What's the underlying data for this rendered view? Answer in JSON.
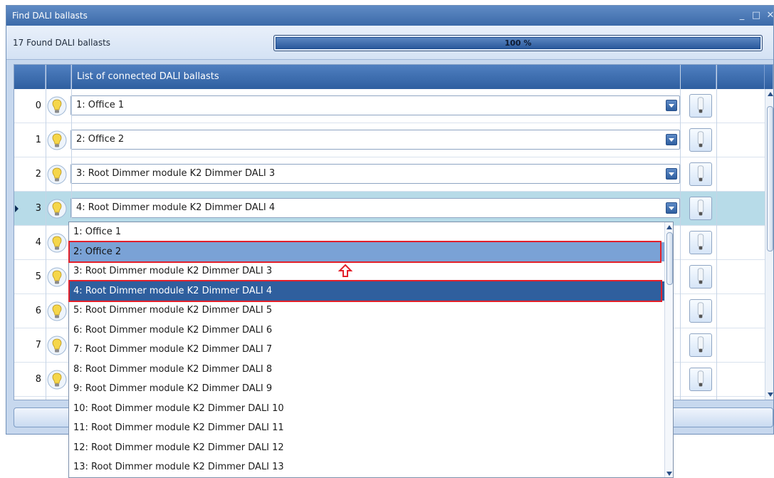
{
  "window": {
    "title": "Find DALI ballasts",
    "controls": [
      "_",
      "□",
      "✕"
    ]
  },
  "status": {
    "found_text": "17 Found DALI ballasts",
    "progress_value": 100,
    "progress_text": "100 %"
  },
  "grid": {
    "header": "List of connected DALI ballasts",
    "rows": [
      {
        "index": "0",
        "value": "1: Office 1"
      },
      {
        "index": "1",
        "value": "2: Office 2"
      },
      {
        "index": "2",
        "value": "3: Root Dimmer module K2 Dimmer DALI 3"
      },
      {
        "index": "3",
        "value": "4: Root Dimmer module K2 Dimmer DALI 4",
        "selected": true
      },
      {
        "index": "4",
        "value": ""
      },
      {
        "index": "5",
        "value": ""
      },
      {
        "index": "6",
        "value": ""
      },
      {
        "index": "7",
        "value": ""
      },
      {
        "index": "8",
        "value": ""
      }
    ]
  },
  "dropdown": {
    "options": [
      "1: Office 1",
      "2: Office 2",
      "3: Root Dimmer module K2 Dimmer DALI 3",
      "4: Root Dimmer module K2 Dimmer DALI 4",
      "5: Root Dimmer module K2 Dimmer DALI 5",
      "6: Root Dimmer module K2 Dimmer DALI 6",
      "7: Root Dimmer module K2 Dimmer DALI 7",
      "8: Root Dimmer module K2 Dimmer DALI 8",
      "9: Root Dimmer module K2 Dimmer DALI 9",
      "10: Root Dimmer module K2 Dimmer DALI 10",
      "11: Root Dimmer module K2 Dimmer DALI 11",
      "12: Root Dimmer module K2 Dimmer DALI 12",
      "13: Root Dimmer module K2 Dimmer DALI 13"
    ],
    "highlighted_index": 1,
    "selected_index": 3
  },
  "icons": {
    "row_icon": "light-bulb-icon",
    "action_icon": "lamp-icon",
    "annotation": "red-up-arrow-icon"
  },
  "colors": {
    "header_blue": "#2f5fa0",
    "selected_row": "#b7dbe8",
    "selected_option": "#2f5f9e",
    "highlight_option": "#7aa2d6",
    "annotation_red": "#e2202a"
  }
}
